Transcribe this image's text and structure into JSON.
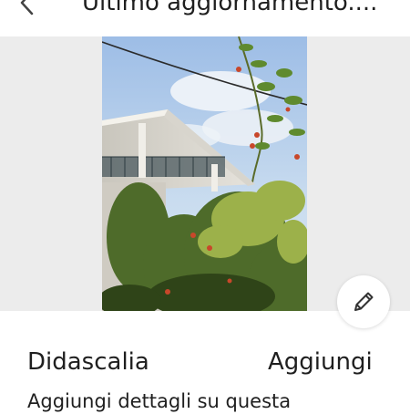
{
  "header": {
    "title": "Ultimo aggiornamento....",
    "back_icon": "chevron-left-icon"
  },
  "photo": {
    "edit_icon": "pencil-icon"
  },
  "caption": {
    "label": "Didascalia",
    "add_label": "Aggiungi",
    "details_hint": "Aggiungi dettagli su questa"
  },
  "colors": {
    "background": "#ffffff",
    "media_background": "#ececec",
    "text": "#1f1f1f"
  }
}
